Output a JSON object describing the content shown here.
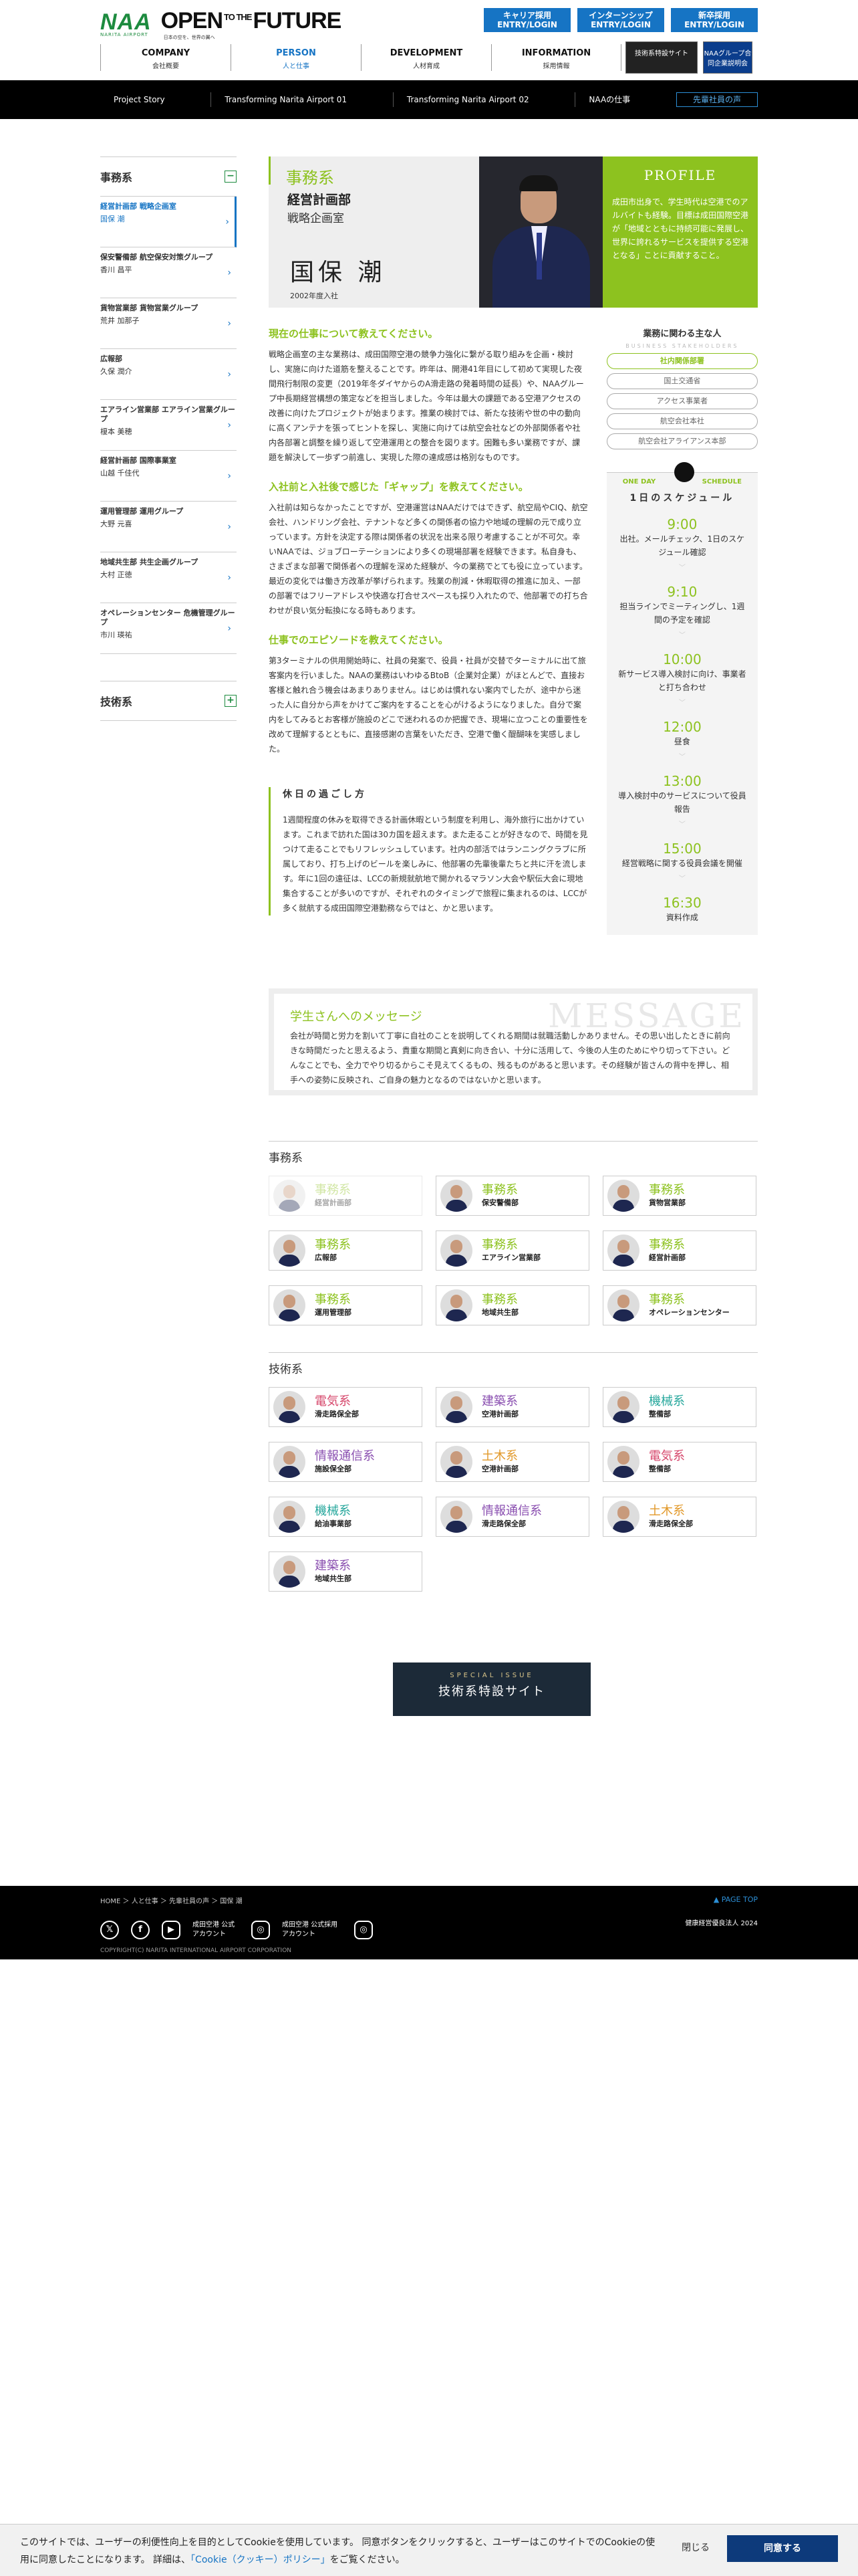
{
  "header": {
    "logo": "NAA",
    "logo_sub": "NARITA AIRPORT",
    "tagline_a": "OPEN",
    "tagline_to": "TO THE",
    "tagline_b": "FUTURE",
    "tagline_sub": "日本の空を、世界の翼へ",
    "entries": [
      {
        "top": "キャリア採用",
        "bottom": "ENTRY/LOGIN"
      },
      {
        "top": "インターンシップ",
        "bottom": "ENTRY/LOGIN"
      },
      {
        "top": "新卒採用",
        "bottom": "ENTRY/LOGIN"
      }
    ],
    "nav": [
      {
        "en": "COMPANY",
        "ja": "会社概要"
      },
      {
        "en": "PERSON",
        "ja": "人と仕事"
      },
      {
        "en": "DEVELOPMENT",
        "ja": "人材育成"
      },
      {
        "en": "INFORMATION",
        "ja": "採用情報"
      }
    ],
    "side_links": [
      "技術系特設サイト",
      "NAAグループ合同企業説明会"
    ]
  },
  "subnav": [
    "Project Story",
    "Transforming Narita Airport 01",
    "Transforming Narita Airport 02",
    "NAAの仕事",
    "先輩社員の声"
  ],
  "sidebar": {
    "head1": "事務系",
    "toggle1": "−",
    "head2": "技術系",
    "toggle2": "+",
    "items": [
      {
        "dept": "経営計画部 戦略企画室",
        "name": "国保 潮"
      },
      {
        "dept": "保安警備部 航空保安対策グループ",
        "name": "香川 昌平"
      },
      {
        "dept": "貨物営業部 貨物営業グループ",
        "name": "荒井 加那子"
      },
      {
        "dept": "広報部",
        "name": "久保 潤介"
      },
      {
        "dept": "エアライン営業部 エアライン営業グループ",
        "name": "榎本 美穂"
      },
      {
        "dept": "経営計画部 国際事業室",
        "name": "山越 千佳代"
      },
      {
        "dept": "運用管理部 運用グループ",
        "name": "大野 元喜"
      },
      {
        "dept": "地域共生部 共生企画グループ",
        "name": "大村 正徳"
      },
      {
        "dept": "オペレーションセンター 危機管理グループ",
        "name": "市川 瑛祐"
      }
    ]
  },
  "hero": {
    "category": "事務系",
    "dept": "経営計画部",
    "section": "戦略企画室",
    "name": "国保 潮",
    "year": "2002年度入社"
  },
  "profile": {
    "title": "PROFILE",
    "text": "成田市出身で、学生時代は空港でのアルバイトも経験。目標は成田国際空港が「地域とともに持続可能に発展し、世界に誇れるサービスを提供する空港となる」ことに貢献すること。"
  },
  "q1": {
    "title": "現在の仕事について教えてください。",
    "text": "戦略企画室の主な業務は、成田国際空港の競争力強化に繋がる取り組みを企画・検討し、実施に向けた道筋を整えることです。昨年は、開港41年目にして初めて実現した夜間飛行制限の変更（2019年冬ダイヤからのA滑走路の発着時間の延長）や、NAAグループ中長期経営構想の策定などを担当しました。今年は最大の課題である空港アクセスの改善に向けたプロジェクトが始まります。推業の検討では、新たな技術や世の中の動向に高くアンテナを張ってヒントを探し、実施に向けては航空会社などの外部関係者や社内各部署と調整を繰り返して空港運用との整合を図ります。困難も多い業務ですが、課題を解決して一歩ずつ前進し、実現した際の達成感は格別なものです。"
  },
  "q2": {
    "title": "入社前と入社後で感じた「ギャップ」を教えてください。",
    "text": "入社前は知らなかったことですが、空港運営はNAAだけではできず、航空局やCIQ、航空会社、ハンドリング会社、テナントなど多くの関係者の協力や地域の理解の元で成り立っています。方針を決定する際は関係者の状況を出来る限り考慮することが不可欠。幸いNAAでは、ジョブローテーションにより多くの現場部署を経験できます。私自身も、さまざまな部署で関係者への理解を深めた経験が、今の業務でとても役に立っています。最近の変化では働き方改革が挙げられます。残業の削減・休暇取得の推進に加え、一部の部署ではフリーアドレスや快適な打合せスペースも採り入れたので、他部署での打ち合わせが良い気分転換になる時もあります。"
  },
  "q3": {
    "title": "仕事でのエピソードを教えてください。",
    "text": "第3ターミナルの供用開始時に、社員の発案で、役員・社員が交替でターミナルに出て旅客案内を行いました。NAAの業務はいわゆるBtoB（企業対企業）がほとんどで、直接お客様と触れ合う機会はあまりありません。はじめは慣れない案内でしたが、途中から迷った人に自分から声をかけてご案内をすることを心がけるようになりました。自分で案内をしてみるとお客様が施設のどこで迷われるのか把握でき、現場に立つことの重要性を改めて理解するとともに、直接感謝の言葉をいただき、空港で働く醍醐味を実感しました。"
  },
  "holiday": {
    "title": "休日の過ごし方",
    "text": "1週間程度の休みを取得できる計画休暇という制度を利用し、海外旅行に出かけています。これまで訪れた国は30カ国を超えます。また走ることが好きなので、時間を見つけて走ることでもリフレッシュしています。社内の部活ではランニングクラブに所属しており、打ち上げのビールを楽しみに、他部署の先輩後輩たちと共に汗を流します。年に1回の遠征は、LCCの新規就航地で開かれるマラソン大会や駅伝大会に現地集合することが多いのですが、それぞれのタイミングで旅程に集まれるのは、LCCが多く就航する成田国際空港勤務ならではと、かと思います。"
  },
  "related": {
    "title": "業務に関わる主な人",
    "sub": "BUSINESS STAKEHOLDERS",
    "tags": [
      "社内関係部署",
      "国土交通省",
      "アクセス事業者",
      "航空会社本社",
      "航空会社アライアンス本部"
    ]
  },
  "schedule": {
    "left": "ONE DAY",
    "right": "SCHEDULE",
    "title": "1日のスケジュール",
    "events": [
      {
        "time": "9:00",
        "desc": "出社。メールチェック、1日のスケジュール確認"
      },
      {
        "time": "9:10",
        "desc": "担当ラインでミーティングし、1週間の予定を確認"
      },
      {
        "time": "10:00",
        "desc": "新サービス導入検討に向け、事業者と打ち合わせ"
      },
      {
        "time": "12:00",
        "desc": "昼食"
      },
      {
        "time": "13:00",
        "desc": "導入検討中のサービスについて役員報告"
      },
      {
        "time": "15:00",
        "desc": "経営戦略に関する役員会議を開催"
      },
      {
        "time": "16:30",
        "desc": "資料作成"
      }
    ]
  },
  "message": {
    "watermark": "MESSAGE",
    "title": "学生さんへのメッセージ",
    "text": "会社が時間と労力を割いて丁寧に自社のことを説明してくれる期間は就職活動しかありません。その思い出したときに前向きな時間だったと思えるよう、貴重な期間と真剣に向き合い、十分に活用して、今後の人生のためにやり切って下さい。どんなことでも、全力でやり切るからこそ見えてくるもの、残るものがあると思います。その経験が皆さんの背中を押し、相手への姿勢に反映され、ご自身の魅力となるのではないかと思います。"
  },
  "admin": {
    "title": "事務系",
    "cards": [
      {
        "c": "事務系",
        "d": "経営計画部"
      },
      {
        "c": "事務系",
        "d": "保安警備部"
      },
      {
        "c": "事務系",
        "d": "貨物営業部"
      },
      {
        "c": "事務系",
        "d": "広報部"
      },
      {
        "c": "事務系",
        "d": "エアライン営業部"
      },
      {
        "c": "事務系",
        "d": "経営計画部"
      },
      {
        "c": "事務系",
        "d": "運用管理部"
      },
      {
        "c": "事務系",
        "d": "地域共生部"
      },
      {
        "c": "事務系",
        "d": "オペレーションセンター"
      }
    ]
  },
  "tech": {
    "title": "技術系",
    "cards": [
      {
        "c": "電気系",
        "d": "滑走路保全部",
        "col": "#d6456a"
      },
      {
        "c": "建築系",
        "d": "空港計画部",
        "col": "#8a4fb0"
      },
      {
        "c": "機械系",
        "d": "整備部",
        "col": "#26a79c"
      },
      {
        "c": "情報通信系",
        "d": "施設保全部",
        "col": "#8a4fb0"
      },
      {
        "c": "土木系",
        "d": "空港計画部",
        "col": "#e2992a"
      },
      {
        "c": "電気系",
        "d": "整備部",
        "col": "#d6456a"
      },
      {
        "c": "機械系",
        "d": "給油事業部",
        "col": "#26a79c"
      },
      {
        "c": "情報通信系",
        "d": "滑走路保全部",
        "col": "#8a4fb0"
      },
      {
        "c": "土木系",
        "d": "滑走路保全部",
        "col": "#e2992a"
      },
      {
        "c": "建築系",
        "d": "地域共生部",
        "col": "#8a4fb0"
      }
    ]
  },
  "special": {
    "top": "SPECIAL ISSUE",
    "main": "技術系特設サイト"
  },
  "footer": {
    "breadcrumb": "HOME ＞ 人と仕事 ＞ 先輩社員の声 ＞ 国保 潮",
    "pagetop": "▲ PAGE TOP",
    "sns1": "成田空港 公式アカウント",
    "sns2": "成田空港 公式採用アカウント",
    "health": "健康経営優良法人 2024",
    "copy": "COPYRIGHT(C) NARITA INTERNATIONAL AIRPORT CORPORATION"
  },
  "cookie": {
    "text": "このサイトでは、ユーザーの利便性向上を目的としてCookieを使用しています。 同意ボタンをクリックすると、ユーザーはこのサイトでのCookieの使用に同意したことになります。 詳細は、",
    "link": "「Cookie（クッキー）ポリシー」",
    "tail": "をご覧ください。",
    "close": "閉じる",
    "agree": "同意する"
  }
}
